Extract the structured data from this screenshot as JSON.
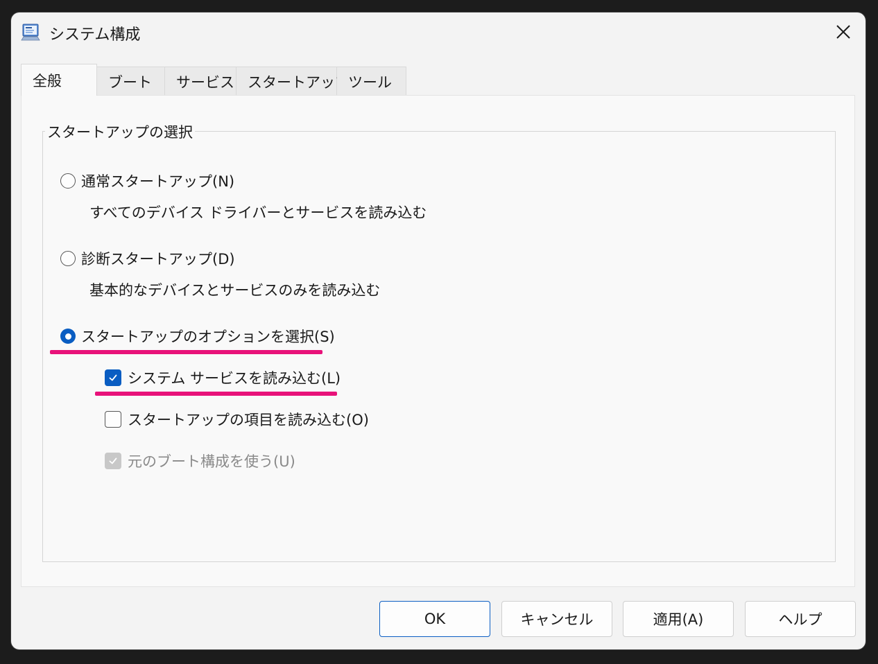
{
  "window": {
    "title": "システム構成",
    "app_icon": "msconfig-icon",
    "close_icon": "close-icon"
  },
  "tabs": [
    {
      "label": "全般",
      "active": true
    },
    {
      "label": "ブート",
      "active": false
    },
    {
      "label": "サービス",
      "active": false
    },
    {
      "label": "スタートアップ",
      "active": false
    },
    {
      "label": "ツール",
      "active": false
    }
  ],
  "startup_selection": {
    "legend": "スタートアップの選択",
    "normal": {
      "label": "通常スタートアップ(N)",
      "description": "すべてのデバイス ドライバーとサービスを読み込む",
      "checked": false
    },
    "diagnostic": {
      "label": "診断スタートアップ(D)",
      "description": "基本的なデバイスとサービスのみを読み込む",
      "checked": false
    },
    "selective": {
      "label": "スタートアップのオプションを選択(S)",
      "checked": true,
      "options": {
        "load_system_services": {
          "label": "システム サービスを読み込む(L)",
          "checked": true
        },
        "load_startup_items": {
          "label": "スタートアップの項目を読み込む(O)",
          "checked": false
        },
        "use_original_boot": {
          "label": "元のブート構成を使う(U)",
          "checked": true,
          "disabled": true
        }
      }
    }
  },
  "buttons": {
    "ok": "OK",
    "cancel": "キャンセル",
    "apply": "適用(A)",
    "help": "ヘルプ"
  },
  "colors": {
    "accent": "#0a5dc2",
    "highlight": "#e8127a",
    "window_bg": "#f3f3f3",
    "panel_bg": "#f9f9f9"
  }
}
